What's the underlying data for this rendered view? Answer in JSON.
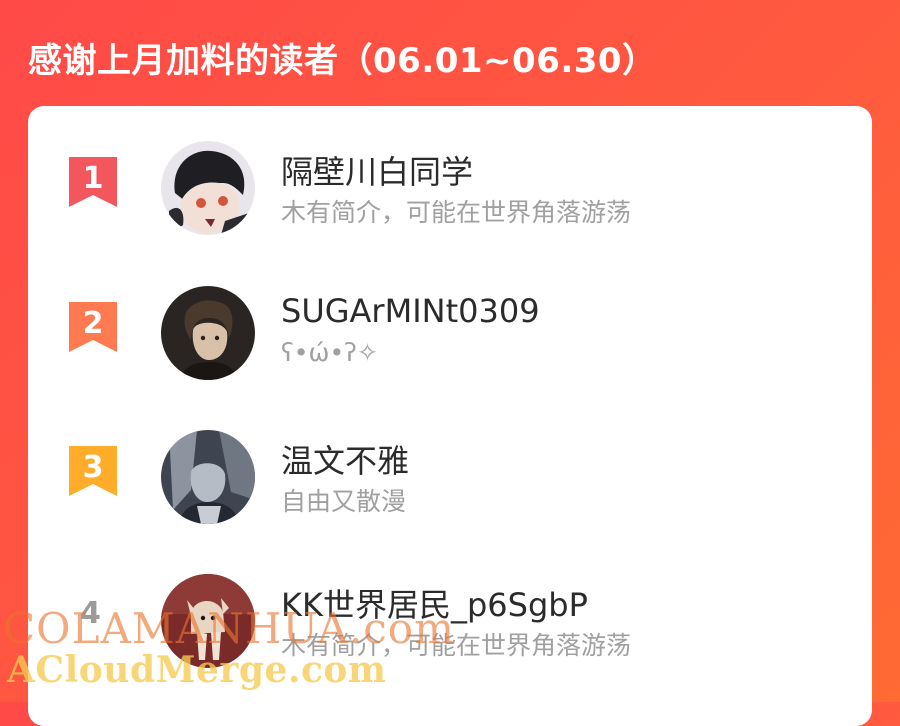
{
  "header": {
    "title": "感谢上月加料的读者（06.01~06.30）"
  },
  "readers": [
    {
      "rank": "1",
      "name": "隔壁川白同学",
      "bio": "木有简介，可能在世界角落游荡",
      "rank_color": "#f3575d",
      "avatar": "anime-dark-hair-character"
    },
    {
      "rank": "2",
      "name": "SUGArMINt0309",
      "bio": "ʕ•ώ•ʔ✧",
      "rank_color": "#ff7a50",
      "avatar": "boy-photo"
    },
    {
      "rank": "3",
      "name": "温文不雅",
      "bio": "自由又散漫",
      "rank_color": "#ffac2b",
      "avatar": "grey-character-art"
    },
    {
      "rank": "4",
      "name": "KK世界居民_p6SgbP",
      "bio": "木有简介，可能在世界角落游荡",
      "avatar": "puppy-photo"
    }
  ],
  "watermarks": {
    "line1": "COLAMANHUA.com",
    "line2": "ACloudMerge.com"
  }
}
